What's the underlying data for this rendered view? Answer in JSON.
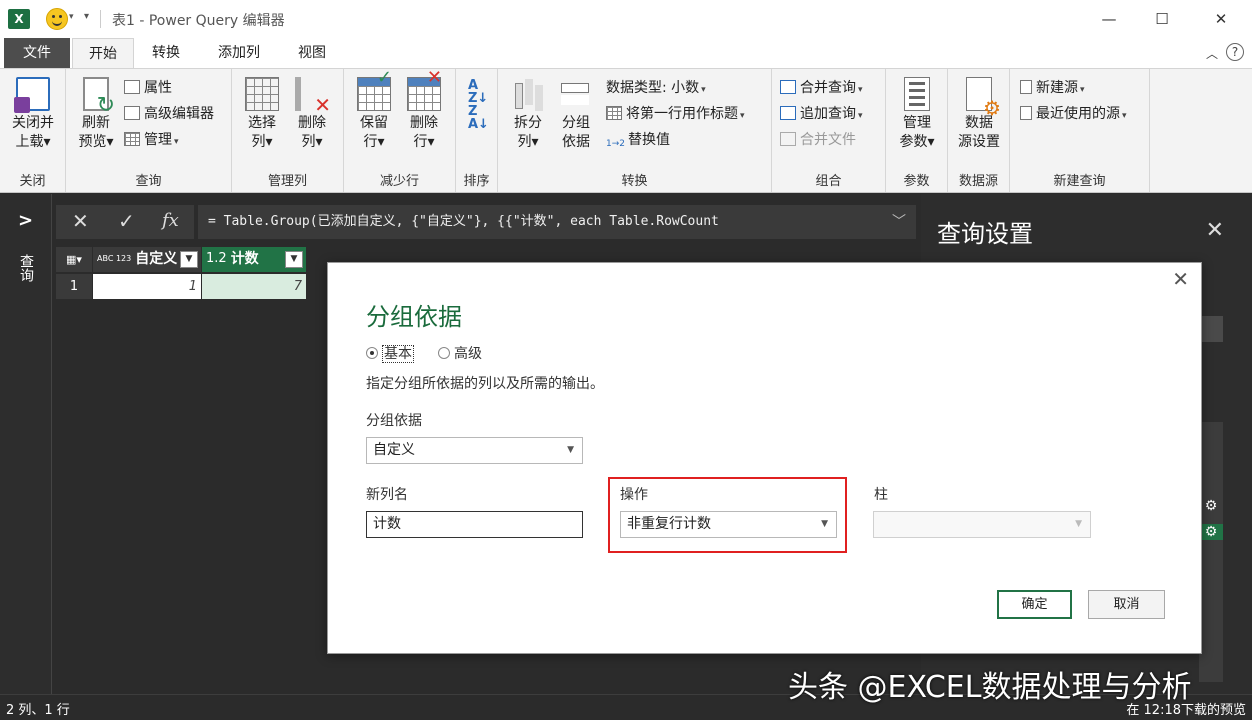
{
  "window": {
    "title": "表1 - Power Query 编辑器",
    "minimize": "—",
    "maximize": "☐",
    "close": "✕"
  },
  "tabs": [
    "文件",
    "开始",
    "转换",
    "添加列",
    "视图"
  ],
  "ribbon": {
    "close_group": {
      "label": "关闭",
      "close_load": [
        "关闭并",
        "上载▾"
      ]
    },
    "query_group": {
      "label": "查询",
      "refresh": [
        "刷新",
        "预览▾"
      ],
      "properties": "属性",
      "advanced_editor": "高级编辑器",
      "manage": "管理"
    },
    "columns_group": {
      "label": "管理列",
      "choose": [
        "选择",
        "列▾"
      ],
      "remove": [
        "删除",
        "列▾"
      ]
    },
    "rows_group": {
      "label": "减少行",
      "keep": [
        "保留",
        "行▾"
      ],
      "remove": [
        "删除",
        "行▾"
      ]
    },
    "sort_group": {
      "label": "排序"
    },
    "transform_group": {
      "label": "转换",
      "split": [
        "拆分",
        "列▾"
      ],
      "group_by": [
        "分组",
        "依据"
      ],
      "data_type": "数据类型: 小数",
      "first_row_header": "将第一行用作标题",
      "replace_values": "替换值",
      "replace_icon": "1→2"
    },
    "combine_group": {
      "label": "组合",
      "merge_queries": "合并查询",
      "append_queries": "追加查询",
      "combine_files": "合并文件"
    },
    "params_group": {
      "label": "参数",
      "manage_params": [
        "管理",
        "参数▾"
      ]
    },
    "datasource_group": {
      "label": "数据源",
      "settings": [
        "数据",
        "源设置"
      ]
    },
    "newquery_group": {
      "label": "新建查询",
      "new_source": "新建源",
      "recent_sources": "最近使用的源"
    }
  },
  "left_pane": {
    "label": "查询"
  },
  "formula_bar": {
    "formula": "= Table.Group(已添加自定义, {\"自定义\"}, {{\"计数\", each Table.RowCount"
  },
  "grid": {
    "columns": [
      {
        "type": "ABC 123",
        "name": "自定义"
      },
      {
        "type": "1.2",
        "name": "计数"
      }
    ],
    "rows": [
      {
        "index": "1",
        "values": [
          "1",
          "7"
        ]
      }
    ]
  },
  "query_settings": {
    "title": "查询设置"
  },
  "dialog": {
    "title": "分组依据",
    "radio_basic": "基本",
    "radio_advanced": "高级",
    "description": "指定分组所依据的列以及所需的输出。",
    "group_by_label": "分组依据",
    "group_by_value": "自定义",
    "new_col_label": "新列名",
    "new_col_value": "计数",
    "operation_label": "操作",
    "operation_value": "非重复行计数",
    "column_label": "柱",
    "column_value": "",
    "ok": "确定",
    "cancel": "取消",
    "highlight_color": "#e02020"
  },
  "status": {
    "left": "2 列、1 行",
    "right": "在 12:18下载的预览"
  },
  "watermark": "头条 @EXCEL数据处理与分析",
  "colors": {
    "accent_green": "#217346",
    "title_green": "#1a6b3c",
    "dark_bg": "#2b2b2b"
  }
}
